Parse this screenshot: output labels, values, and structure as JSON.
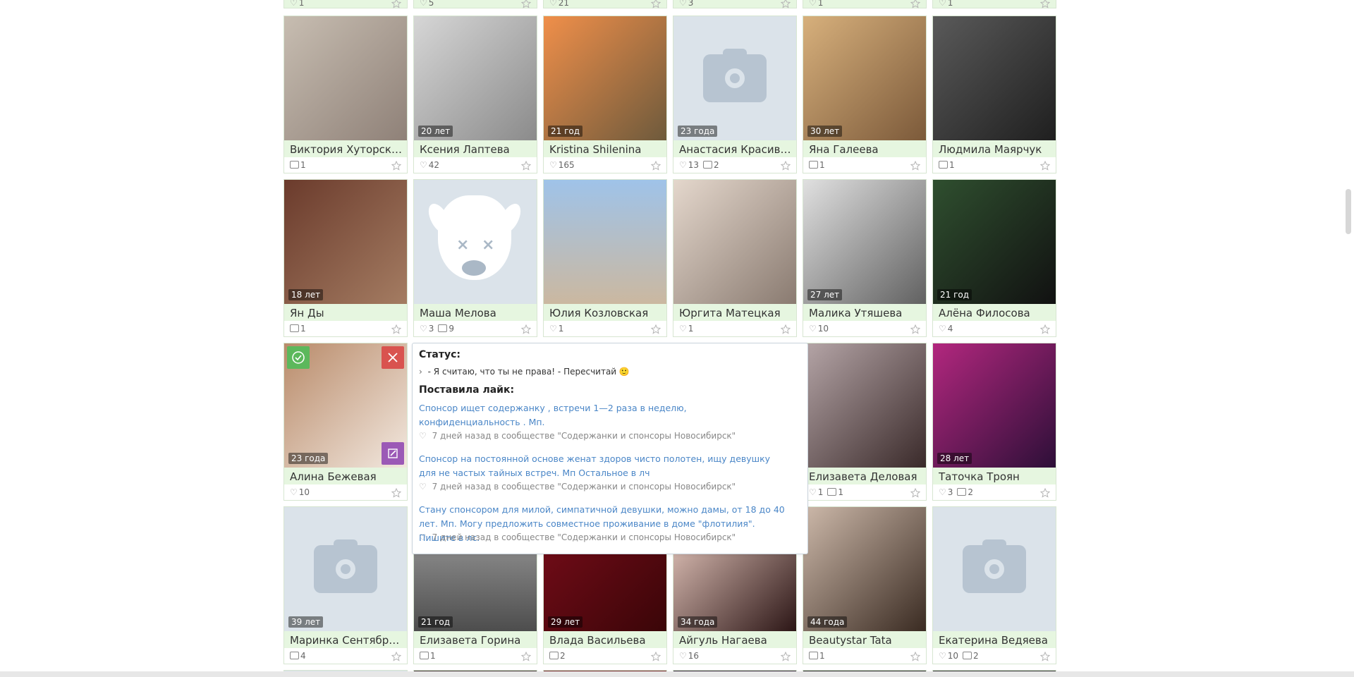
{
  "top_row": [
    {
      "likes": "1"
    },
    {
      "likes": "5"
    },
    {
      "likes": "21"
    },
    {
      "likes": "3"
    },
    {
      "likes": "1"
    },
    {
      "likes": "1"
    }
  ],
  "rows": [
    [
      {
        "name": "Виктория Хуторская",
        "age": "",
        "stats": {
          "comments": "1"
        },
        "photo": "cat"
      },
      {
        "name": "Ксения Лаптева",
        "age": "20 лет",
        "stats": {
          "likes": "42"
        },
        "photo": "gray"
      },
      {
        "name": "Kristina Shilenina",
        "age": "21 год",
        "stats": {
          "likes": "165"
        },
        "photo": "fox"
      },
      {
        "name": "Анастасия Красивых",
        "age": "23 года",
        "stats": {
          "likes": "13",
          "comments": "2"
        },
        "photo": "camera"
      },
      {
        "name": "Яна Галеева",
        "age": "30 лет",
        "stats": {
          "comments": "1"
        },
        "photo": "warm"
      },
      {
        "name": "Людмила Маярчук",
        "age": "",
        "stats": {
          "photos": "1"
        },
        "photo": "dark"
      }
    ],
    [
      {
        "name": "Ян Ды",
        "age": "18 лет",
        "stats": {
          "comments": "1"
        },
        "photo": "brown"
      },
      {
        "name": "Маша Мелова",
        "age": "",
        "stats": {
          "likes": "3",
          "comments": "9"
        },
        "photo": "vk"
      },
      {
        "name": "Юлия Козловская",
        "age": "",
        "stats": {
          "likes": "1"
        },
        "photo": "beach"
      },
      {
        "name": "Юргита Матецкая",
        "age": "",
        "stats": {
          "likes": "1"
        },
        "photo": "pale"
      },
      {
        "name": "Малика Утяшева",
        "age": "27 лет",
        "stats": {
          "likes": "10"
        },
        "photo": "bw"
      },
      {
        "name": "Алёна Филосова",
        "age": "21 год",
        "stats": {
          "likes": "4"
        },
        "photo": "green"
      }
    ],
    [
      {
        "name": "Алина Бежевая",
        "age": "23 года",
        "stats": {
          "likes": "10"
        },
        "photo": "selfie",
        "special": true
      },
      {
        "name": "",
        "age": "",
        "stats": {},
        "photo": "hidden"
      },
      {
        "name": "",
        "age": "",
        "stats": {},
        "photo": "hidden"
      },
      {
        "name": "",
        "age": "",
        "stats": {},
        "photo": "hidden"
      },
      {
        "name": "Елизавета Деловая",
        "age": "",
        "stats": {
          "likes": "1",
          "comments": "1"
        },
        "photo": "cat2"
      },
      {
        "name": "Таточка Троян",
        "age": "28 лет",
        "stats": {
          "likes": "3",
          "comments": "2"
        },
        "photo": "purple"
      }
    ],
    [
      {
        "name": "Маринка Сентябрь...",
        "age": "39 лет",
        "stats": {
          "comments": "4"
        },
        "photo": "camera"
      },
      {
        "name": "Елизавета Горина",
        "age": "21 год",
        "stats": {
          "comments": "1"
        },
        "photo": "street"
      },
      {
        "name": "Влада Васильева",
        "age": "29 лет",
        "stats": {
          "comments": "2"
        },
        "photo": "roses"
      },
      {
        "name": "Айгуль Нагаева",
        "age": "34 года",
        "stats": {
          "likes": "16"
        },
        "photo": "lips"
      },
      {
        "name": "Beautystar Tata",
        "age": "44 года",
        "stats": {
          "comments": "1"
        },
        "photo": "lashes"
      },
      {
        "name": "Екатерина Ведяева",
        "age": "",
        "stats": {
          "likes": "10",
          "comments": "2"
        },
        "photo": "camera"
      }
    ]
  ],
  "popup": {
    "status_heading": "Статус:",
    "status_text": "- Я считаю, что ты не права! - Пересчитай 🙂",
    "likes_heading": "Поставила лайк:",
    "items": [
      {
        "text": "Спонсор ищет содержанку , встречи 1—2 раза в неделю, конфиденциальность . Мп.",
        "meta": "7 дней назад в сообществе \"Содержанки и спонсоры Новосибирск\""
      },
      {
        "text": "Спонсор на постоянной основе женат здоров чисто полотен, ищу девушку для не частых тайных встреч. Мп Остальное в лч",
        "meta": "7 дней назад в сообществе \"Содержанки и спонсоры Новосибирск\""
      },
      {
        "text": "Стану спонсором для милой, симпатичной девушки, можно дамы, от 18 до 40 лет. Мп. Могу предложить совместное проживание в доме \"флотилия\". Пишите в лс.",
        "meta": "7 дней назад в сообществе \"Содержанки и спонсоры Новосибирск\""
      }
    ]
  }
}
